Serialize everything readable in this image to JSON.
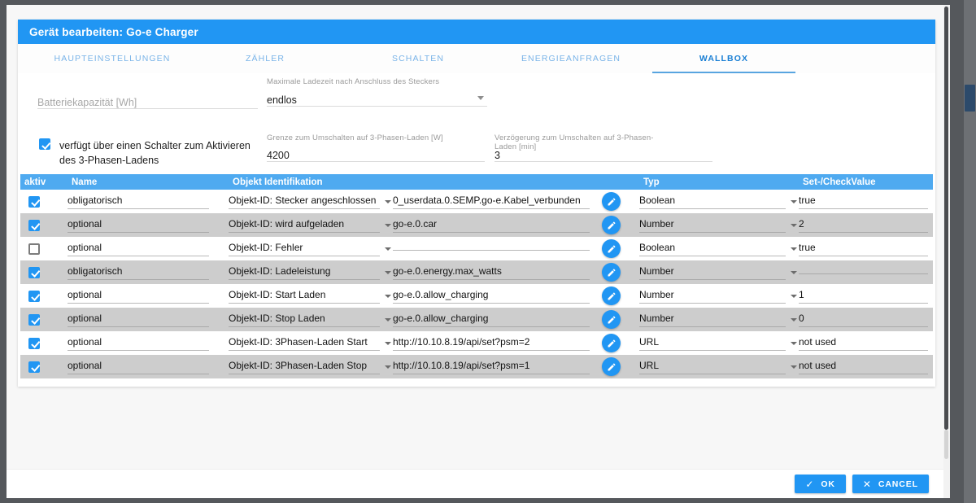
{
  "dialog": {
    "title": "Gerät bearbeiten: Go-e Charger"
  },
  "tabs": [
    {
      "label": "HAUPTEINSTELLUNGEN",
      "active": false
    },
    {
      "label": "ZÄHLER",
      "active": false
    },
    {
      "label": "SCHALTEN",
      "active": false
    },
    {
      "label": "ENERGIEANFRAGEN",
      "active": false
    },
    {
      "label": "WALLBOX",
      "active": true
    }
  ],
  "form": {
    "battery": {
      "placeholder": "Batteriekapazität [Wh]",
      "value": ""
    },
    "max_charge_time": {
      "label": "Maximale Ladezeit nach Anschluss des Steckers",
      "value": "endlos"
    },
    "three_phase_switch": {
      "label": "verfügt über einen Schalter zum Aktivieren des 3-Phasen-Ladens",
      "checked": true
    },
    "threshold": {
      "label": "Grenze zum Umschalten auf 3-Phasen-Laden [W]",
      "value": "4200"
    },
    "delay": {
      "label": "Verzögerung zum Umschalten auf 3-Phasen-Laden [min]",
      "value": "3"
    }
  },
  "table": {
    "headers": {
      "aktiv": "aktiv",
      "name": "Name",
      "objekt": "Objekt Identifikation",
      "typ": "Typ",
      "checkvalue": "Set-/CheckValue"
    },
    "rows": [
      {
        "active": true,
        "name": "obligatorisch",
        "objekt": "Objekt-ID: Stecker angeschlossen",
        "ident": "0_userdata.0.SEMP.go-e.Kabel_verbunden",
        "typ": "Boolean",
        "checkvalue": "true"
      },
      {
        "active": true,
        "name": "optional",
        "objekt": "Objekt-ID: wird aufgeladen",
        "ident": "go-e.0.car",
        "typ": "Number",
        "checkvalue": "2"
      },
      {
        "active": false,
        "name": "optional",
        "objekt": "Objekt-ID: Fehler",
        "ident": "",
        "typ": "Boolean",
        "checkvalue": "true"
      },
      {
        "active": true,
        "name": "obligatorisch",
        "objekt": "Objekt-ID: Ladeleistung",
        "ident": "go-e.0.energy.max_watts",
        "typ": "Number",
        "checkvalue": ""
      },
      {
        "active": true,
        "name": "optional",
        "objekt": "Objekt-ID: Start Laden",
        "ident": "go-e.0.allow_charging",
        "typ": "Number",
        "checkvalue": "1"
      },
      {
        "active": true,
        "name": "optional",
        "objekt": "Objekt-ID: Stop Laden",
        "ident": "go-e.0.allow_charging",
        "typ": "Number",
        "checkvalue": "0"
      },
      {
        "active": true,
        "name": "optional",
        "objekt": "Objekt-ID: 3Phasen-Laden Start",
        "ident": "http://10.10.8.19/api/set?psm=2",
        "typ": "URL",
        "checkvalue": "not used"
      },
      {
        "active": true,
        "name": "optional",
        "objekt": "Objekt-ID: 3Phasen-Laden Stop",
        "ident": "http://10.10.8.19/api/set?psm=1",
        "typ": "URL",
        "checkvalue": "not used"
      }
    ]
  },
  "footer": {
    "ok_label": "OK",
    "cancel_label": "CANCEL"
  },
  "colors": {
    "accent": "#2196f3",
    "header_blue": "#4faaf0",
    "row_alt": "#cdcdcd"
  }
}
